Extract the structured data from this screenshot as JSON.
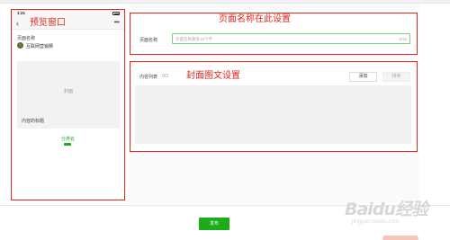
{
  "preview_panel": {
    "status_time": "1:21",
    "back_icon": "chevron-left-icon",
    "more_icon": "more-dots-icon",
    "annotation": "预览窗口",
    "page_name_label": "页面名称",
    "account_name": "互联网营销狮",
    "cover_label": "封面",
    "content_title": "内容的标题",
    "tab_label": "分类名"
  },
  "page_name_section": {
    "annotation": "页面名称在此设置",
    "label": "页面名称",
    "placeholder": "页面名称最多16个字",
    "counter": "0/16"
  },
  "cover_section": {
    "annotation": "封面图文设置",
    "content_list_label": "内容列表",
    "content_list_count": "0/3",
    "add_button": "添加",
    "sort_button": "排序"
  },
  "footer": {
    "publish_button": "发布"
  },
  "watermark": {
    "text": "Baidu经验",
    "sub": "jingyan.baidu.com"
  },
  "colors": {
    "accent_green": "#1aad19",
    "annotation_red": "#e2281e"
  }
}
